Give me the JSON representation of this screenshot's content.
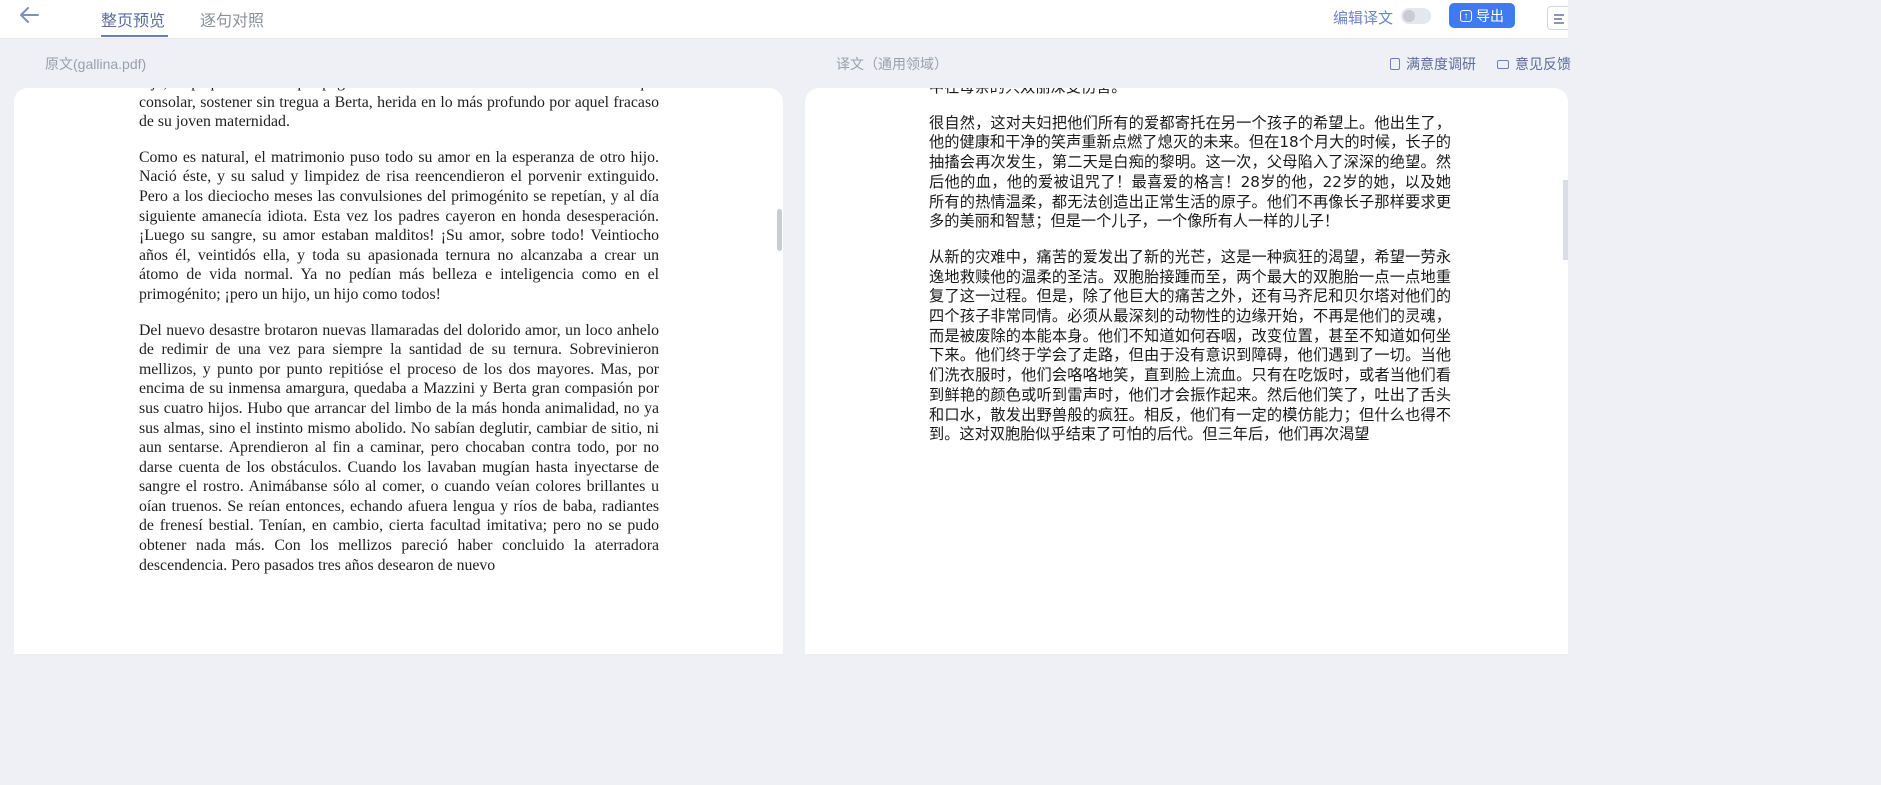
{
  "topbar": {
    "tabs": [
      {
        "label": "整页预览",
        "active": true
      },
      {
        "label": "逐句对照",
        "active": false
      }
    ],
    "edit_label": "编辑译文",
    "export_label": "导出",
    "export_icon": "upload-icon"
  },
  "source_pane": {
    "title": "原文(gallina.pdf)",
    "paragraphs": [
      "hijo, el pequeño idiota que pagaba los excesos del abuelo. Tuvo asimismo que consolar, sostener sin tregua a Berta, herida en lo más profundo por aquel fracaso de su joven maternidad.",
      "Como es natural, el matrimonio puso todo su amor en la esperanza de otro hijo. Nació éste, y su salud y limpidez de risa reencendieron el porvenir extinguido. Pero a los dieciocho meses las convulsiones del primogénito se repetían, y al día siguiente amanecía idiota. Esta vez los padres cayeron en honda desesperación. ¡Luego su sangre, su amor estaban malditos! ¡Su amor, sobre todo! Veintiocho años él, veintidós ella, y toda su apasionada ternura no alcanzaba a crear un átomo de vida normal. Ya no pedían más belleza e inteligencia como en el primogénito; ¡pero un hijo, un hijo como todos!",
      "Del nuevo desastre brotaron nuevas llamaradas del dolorido amor, un loco anhelo de redimir de una vez para siempre la santidad de su ternura. Sobrevinieron mellizos, y punto por punto repitióse el proceso de los dos mayores. Mas, por encima de su inmensa amargura, quedaba a Mazzini y Berta gran compasión por sus cuatro hijos. Hubo que arrancar del limbo de la más honda animalidad, no ya sus almas, sino el instinto mismo abolido. No sabían deglutir, cambiar de sitio, ni aun sentarse. Aprendieron al fin a caminar, pero chocaban contra todo, por no darse cuenta de los obstáculos. Cuando los lavaban mugían hasta inyectarse de sangre el rostro. Animábanse sólo al comer, o cuando veían colores brillantes u oían truenos. Se reían entonces, echando afuera lengua y ríos de baba, radiantes de frenesí bestial. Tenían, en cambio, cierta facultad imitativa; pero no se pudo obtener nada más. Con los mellizos pareció haber concluido la aterradora descendencia. Pero pasados tres años desearon de nuevo"
    ]
  },
  "target_pane": {
    "title": "译文（通用领域）",
    "survey_label": "满意度调研",
    "feedback_label": "意见反馈",
    "paragraphs": [
      "中在母亲的只双丽深受伤害。",
      "很自然，这对夫妇把他们所有的爱都寄托在另一个孩子的希望上。他出生了，他的健康和干净的笑声重新点燃了熄灭的未来。但在18个月大的时候，长子的抽搐会再次发生，第二天是白痴的黎明。这一次，父母陷入了深深的绝望。然后他的血，他的爱被诅咒了！最喜爱的格言！28岁的他，22岁的她，以及她所有的热情温柔，都无法创造出正常生活的原子。他们不再像长子那样要求更多的美丽和智慧；但是一个儿子，一个像所有人一样的儿子！",
      "从新的灾难中，痛苦的爱发出了新的光芒，这是一种疯狂的渴望，希望一劳永逸地救赎他的温柔的圣洁。双胞胎接踵而至，两个最大的双胞胎一点一点地重复了这一过程。但是，除了他巨大的痛苦之外，还有马齐尼和贝尔塔对他们的四个孩子非常同情。必须从最深刻的动物性的边缘开始，不再是他们的灵魂，而是被废除的本能本身。他们不知道如何吞咽，改变位置，甚至不知道如何坐下来。他们终于学会了走路，但由于没有意识到障碍，他们遇到了一切。当他们洗衣服时，他们会咯咯地笑，直到脸上流血。只有在吃饭时，或者当他们看到鲜艳的颜色或听到雷声时，他们才会振作起来。然后他们笑了，吐出了舌头和口水，散发出野兽般的疯狂。相反，他们有一定的模仿能力；但什么也得不到。这对双胞胎似乎结束了可怕的后代。但三年后，他们再次渴望"
    ]
  }
}
